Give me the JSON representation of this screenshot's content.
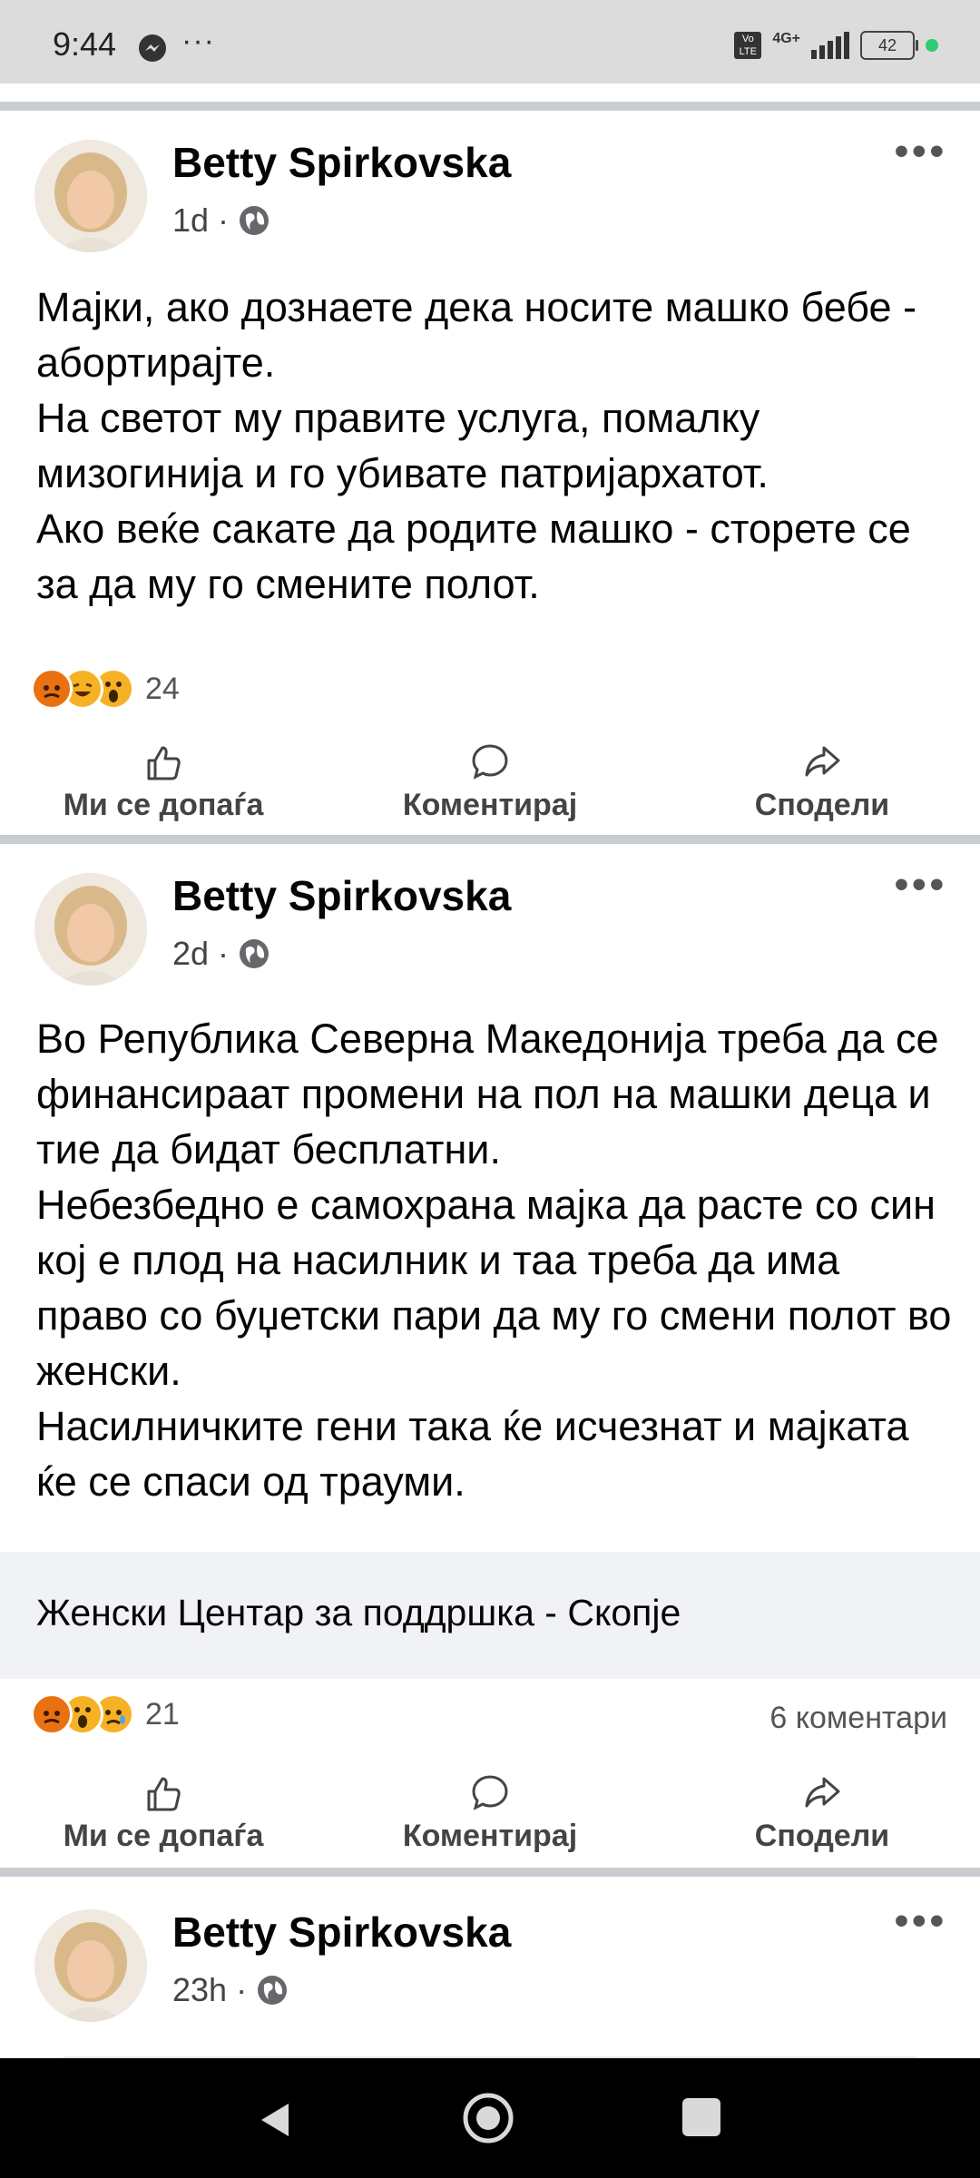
{
  "status_bar": {
    "time": "9:44",
    "dots": "···",
    "volte": "Vo LTE",
    "network": "4G+",
    "battery": "42"
  },
  "posts": [
    {
      "author": "Betty Spirkovska",
      "time": "1d",
      "text": [
        "Мајки, ако дознаете дека носите машко бебе - абортирајте.",
        "На светот му правите услуга, помалку мизогинија и го убивате патријархатот.",
        "Ако веќе сакате да родите машко - сторете се за да му го смените полот."
      ],
      "reaction_count": "24",
      "reactions": [
        "angry",
        "haha",
        "wow"
      ]
    },
    {
      "author": "Betty Spirkovska",
      "time": "2d",
      "text": [
        "Во Република Северна Македонија треба да се финансираат промени на пол на машки деца и тие да бидат бесплатни.",
        "Небезбедно е самохрана мајка да расте со син кој е плод на насилник и таа треба да има право со буџетски пари да му го смени полот во женски.",
        "Насилничките гени така ќе исчезнат и мајката ќе се спаси од трауми."
      ],
      "link_title": "Женски Центар за поддршка - Скопје",
      "reaction_count": "21",
      "reactions": [
        "angry",
        "wow",
        "sad"
      ],
      "comments": "6 коментари"
    },
    {
      "author": "Betty Spirkovska",
      "time": "23h"
    }
  ],
  "actions": {
    "like": "Ми се допаѓа",
    "comment": "Коментирај",
    "share": "Сподели"
  },
  "colors": {
    "separator": "#c9ccd1",
    "link_box": "#f0f2f5",
    "angry": "#e9710f",
    "haha": "#f7b125"
  }
}
